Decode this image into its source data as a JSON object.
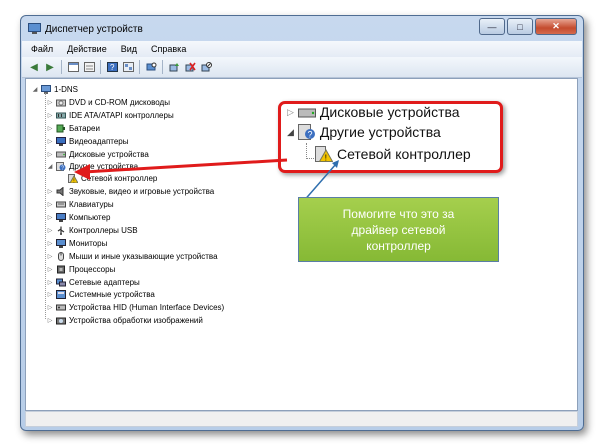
{
  "window": {
    "title": "Диспетчер устройств",
    "controls": [
      "—",
      "□",
      "✕"
    ]
  },
  "menu": [
    "Файл",
    "Действие",
    "Вид",
    "Справка"
  ],
  "tree": {
    "root": "1-DNS",
    "items": [
      "DVD и CD-ROM дисководы",
      "IDE ATA/ATAPI контроллеры",
      "Батареи",
      "Видеоадаптеры",
      "Дисковые устройства",
      "Другие устройства",
      "Сетевой контроллер",
      "Звуковые, видео и игровые устройства",
      "Клавиатуры",
      "Компьютер",
      "Контроллеры USB",
      "Мониторы",
      "Мыши и иные указывающие устройства",
      "Процессоры",
      "Сетевые адаптеры",
      "Системные устройства",
      "Устройства HID (Human Interface Devices)",
      "Устройства обработки изображений"
    ]
  },
  "zoom_callout": {
    "row1": "Дисковые устройства",
    "row2": "Другие устройства",
    "row3": "Сетевой контроллер"
  },
  "note": {
    "text": "Помогите что это за драйвер сетевой контроллер"
  },
  "colors": {
    "callout_border": "#e01b1b",
    "note_bg": "#93c33f",
    "arrow_blue": "#2f6fae"
  }
}
